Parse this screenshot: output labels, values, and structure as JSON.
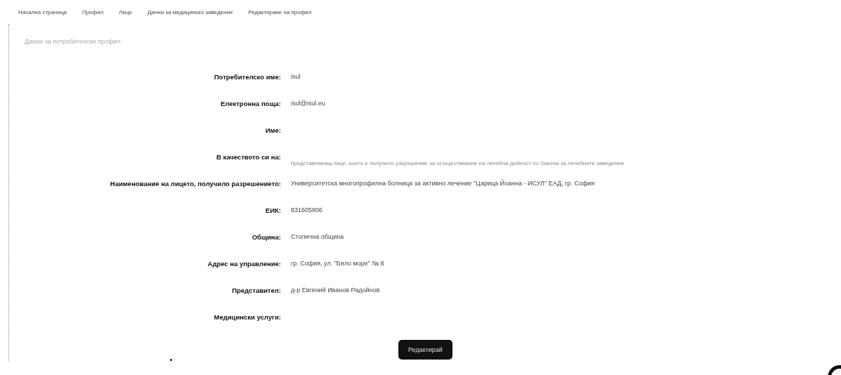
{
  "breadcrumb": [
    "Начална страница",
    "Профил",
    "Лице",
    "Данни за медицинско заведение",
    "Редактиране на профил"
  ],
  "subtitle": "Данни за потребителски профил",
  "fields": [
    {
      "label": "Потребителско име:",
      "value": "isul"
    },
    {
      "label": "Електронна поща:",
      "value": "isul@isul.eu"
    },
    {
      "label": "Име:"
    },
    {
      "label": "В качеството си на:",
      "note": "представляващ лице, което е получило разрешение за осъществяване на лечебна дейност по Закона за лечебните заведения"
    },
    {
      "label": "Наименование на лицето, получило разрешението:",
      "value": "Университетска многопрофилна болница за активно лечение \"Царица Йоанна - ИСУЛ\" ЕАД, гр. София"
    },
    {
      "label": "ЕИК:",
      "value": "831605806"
    },
    {
      "label": "Община:",
      "value": "Столична община"
    },
    {
      "label": "Адрес на управление:",
      "value": "гр. София, ул. \"Бяло море\" № 8"
    },
    {
      "label": "Представител:",
      "value": "д-р Евгений Иванов Радойнов"
    },
    {
      "label": "Медицински услуги:"
    }
  ],
  "edit_button": "Редактирай"
}
